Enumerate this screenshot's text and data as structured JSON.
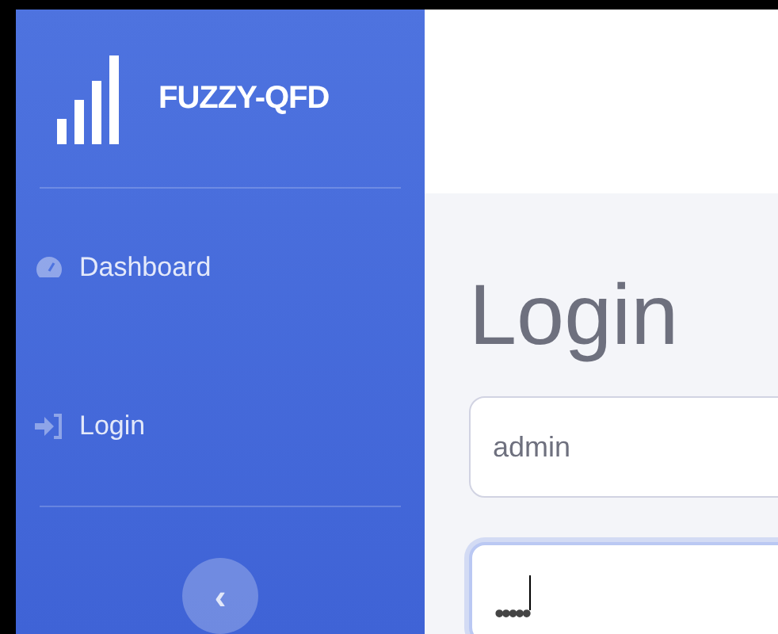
{
  "sidebar": {
    "brand": "FUZZY-QFD",
    "items": [
      {
        "kind": "dashboard",
        "label": "Dashboard"
      },
      {
        "kind": "login",
        "label": "Login"
      }
    ],
    "toggle": "‹"
  },
  "main": {
    "heading": "Login",
    "username": {
      "value": "admin"
    },
    "password": {
      "value": "•••••",
      "focused": true
    }
  }
}
